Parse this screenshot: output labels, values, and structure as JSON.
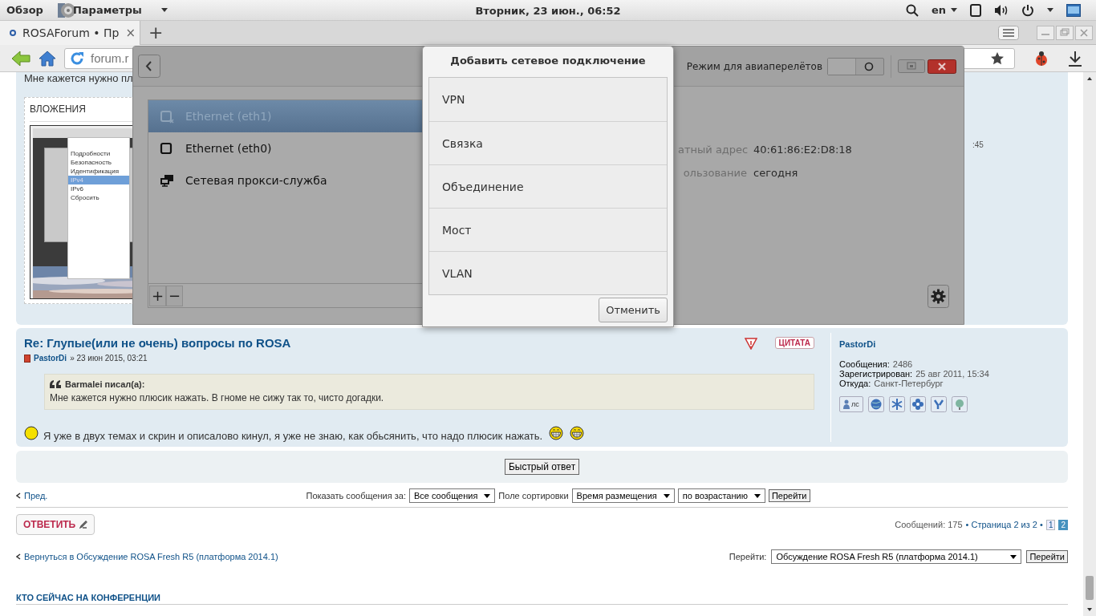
{
  "top_bar": {
    "activities": "Обзор",
    "app_menu": "Параметры",
    "clock": "Вторник, 23 июн., 06:52",
    "keyboard_layout": "en"
  },
  "browser": {
    "tabs": [
      {
        "title": "ROSAForum • Пр",
        "selected": true,
        "close": "×"
      }
    ],
    "new_tab": "+",
    "url": "forum.r"
  },
  "forum": {
    "previous_post": {
      "text": "Мне кажется нужно пл",
      "attachments_heading": "ВЛОЖЕНИЯ",
      "attachment_menu": [
        {
          "label": "Подробности",
          "selected": false
        },
        {
          "label": "Безопасность",
          "selected": false
        },
        {
          "label": "Идентификация",
          "selected": false
        },
        {
          "label": "IPv4",
          "selected": true
        },
        {
          "label": "IPv6",
          "selected": false
        },
        {
          "label": "Сбросить",
          "selected": false
        }
      ],
      "profile_fragment": ":45"
    },
    "post": {
      "title": "Re: Глупые(или не очень) вопросы по ROSA",
      "author": "PastorDi",
      "date": "» 23 июн 2015, 03:21",
      "quote_button": "ЦИТАТА",
      "quote": {
        "author": "Barmalei писал(а):",
        "text": "Мне кажется нужно плюсик нажать. В гноме не сижу так то, чисто догадки."
      },
      "text": "Я уже в двух темах и скрин и описалово кинул, я уже не знаю, как обьсянить, что надо плюсик нажать.",
      "profile": {
        "name": "PastorDi",
        "fields": [
          {
            "label": "Сообщения:",
            "value": "2486"
          },
          {
            "label": "Зарегистрирован:",
            "value": "25 авг 2011, 15:34"
          },
          {
            "label": "Откуда:",
            "value": "Санкт-Петербург"
          }
        ],
        "pm_label": "лс"
      }
    },
    "quick_reply": "Быстрый ответ",
    "topic_nav": {
      "previous": "Пред.",
      "display_label": "Показать сообщения за:",
      "display_value": "Все сообщения",
      "sort_label": "Поле сортировки",
      "sort_value": "Время размещения",
      "order_value": "по возрастанию",
      "go": "Перейти"
    },
    "reply_button": "ОТВЕТИТЬ",
    "pagination": {
      "summary": "Сообщений: 175",
      "page_info": "• Страница 2 из 2 •",
      "pages": [
        {
          "label": "1",
          "selected": false
        },
        {
          "label": "2",
          "selected": true
        }
      ]
    },
    "return_link": "Вернуться в Обсуждение ROSA Fresh R5 (платформа 2014.1)",
    "jump": {
      "label": "Перейти:",
      "value": "Обсуждение ROSA Fresh R5 (платформа 2014.1)",
      "go": "Перейти"
    },
    "online_heading": "КТО СЕЙЧАС НА КОНФЕРЕНЦИИ"
  },
  "network_window": {
    "airplane_mode_label": "Режим для авиаперелётов",
    "airplane_mode": false,
    "devices": [
      {
        "name": "Ethernet (eth1)",
        "kind": "ethernet-off",
        "selected": true
      },
      {
        "name": "Ethernet (eth0)",
        "kind": "ethernet",
        "selected": false
      },
      {
        "name": "Сетевая прокси-служба",
        "kind": "proxy",
        "selected": false
      }
    ],
    "details": [
      {
        "label": "атный адрес",
        "value": "40:61:86:E2:D8:18"
      },
      {
        "label": "ользование",
        "value": "сегодня"
      }
    ],
    "add": "+",
    "remove": "−"
  },
  "add_connection_dialog": {
    "title": "Добавить сетевое подключение",
    "types": [
      "VPN",
      "Связка",
      "Объединение",
      "Мост",
      "VLAN"
    ],
    "cancel": "Отменить"
  }
}
